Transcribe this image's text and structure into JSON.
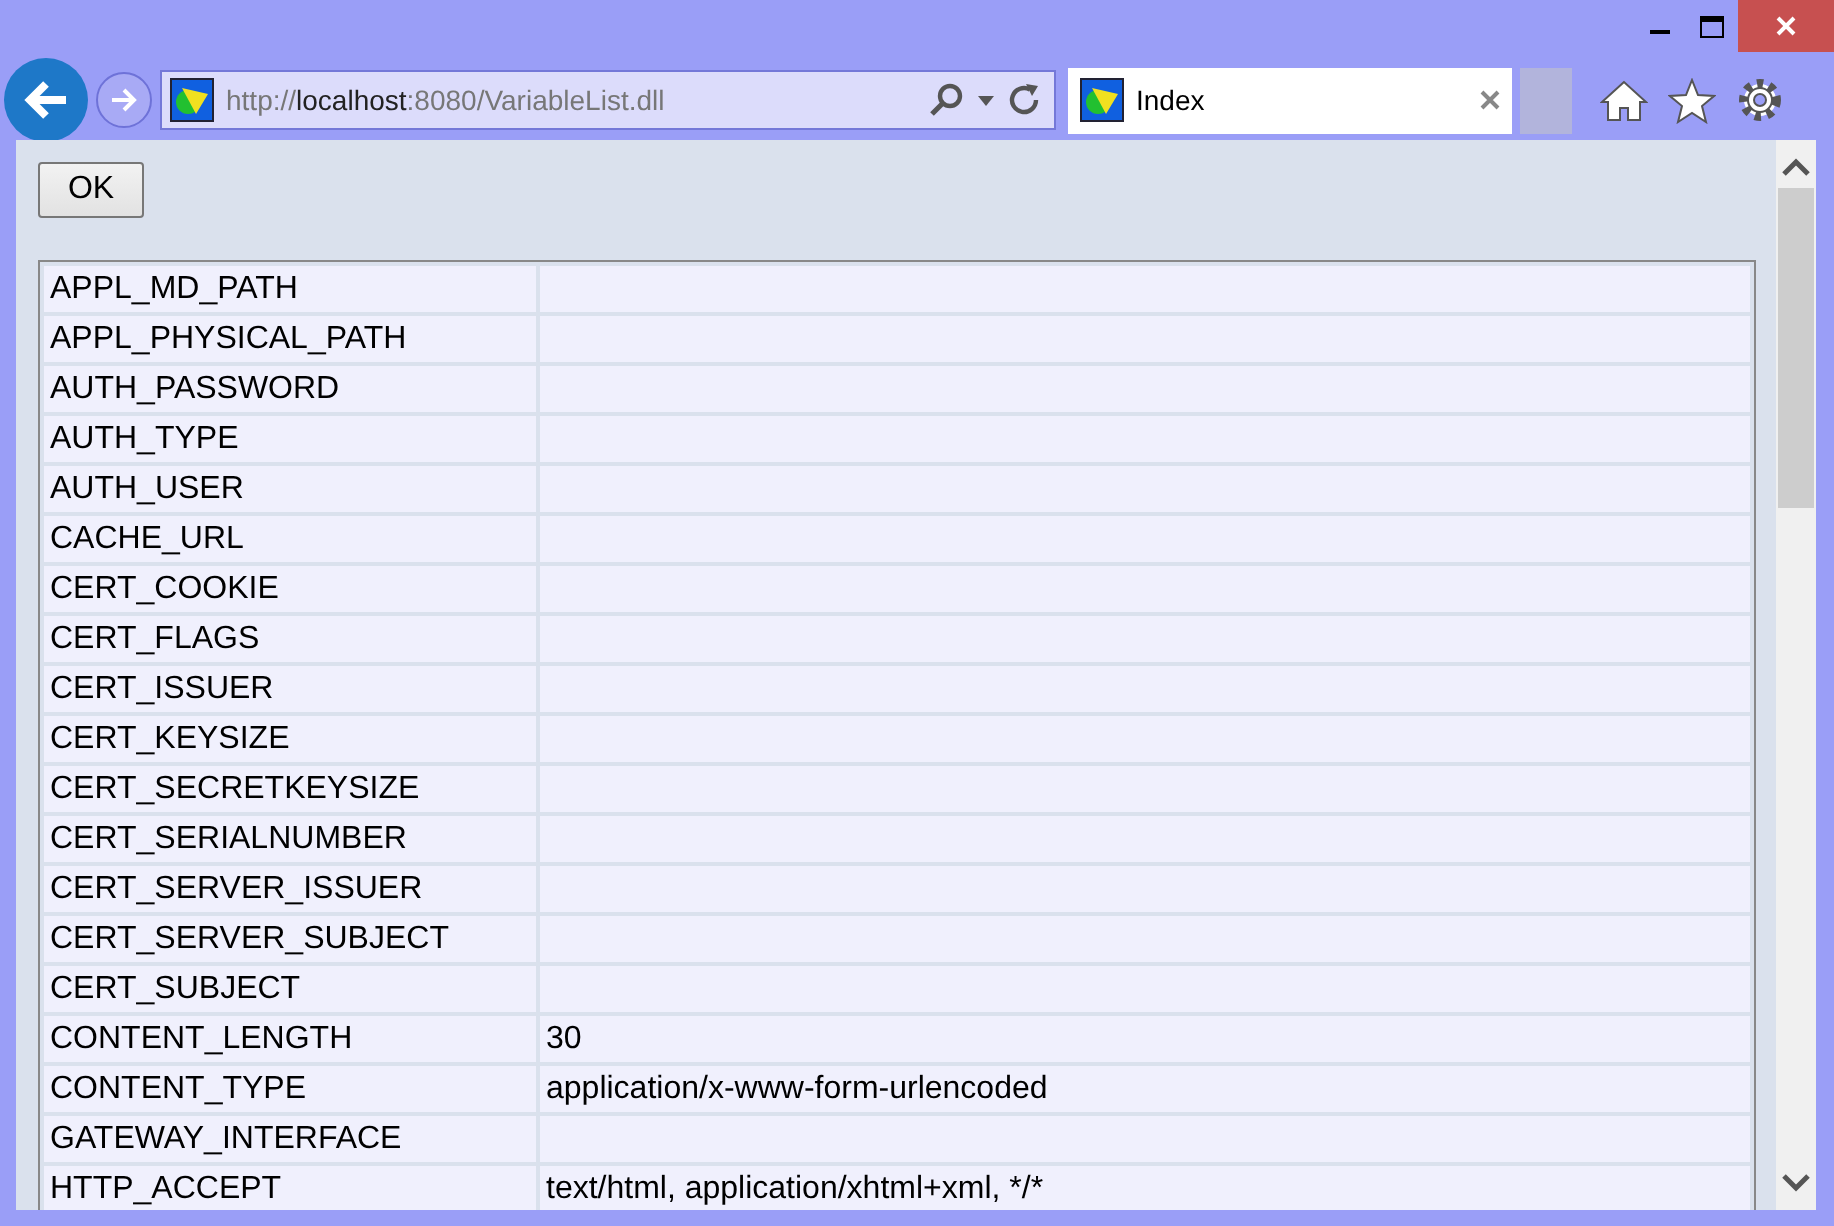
{
  "address_bar": {
    "url_prefix": "http://",
    "url_host": "localhost",
    "url_suffix": ":8080/VariableList.dll"
  },
  "tabs": [
    {
      "label": "Index",
      "selected": true
    }
  ],
  "ok_button": "OK",
  "table": {
    "rows": [
      {
        "name": "APPL_MD_PATH",
        "value": ""
      },
      {
        "name": "APPL_PHYSICAL_PATH",
        "value": ""
      },
      {
        "name": "AUTH_PASSWORD",
        "value": ""
      },
      {
        "name": "AUTH_TYPE",
        "value": ""
      },
      {
        "name": "AUTH_USER",
        "value": ""
      },
      {
        "name": "CACHE_URL",
        "value": ""
      },
      {
        "name": "CERT_COOKIE",
        "value": ""
      },
      {
        "name": "CERT_FLAGS",
        "value": ""
      },
      {
        "name": "CERT_ISSUER",
        "value": ""
      },
      {
        "name": "CERT_KEYSIZE",
        "value": ""
      },
      {
        "name": "CERT_SECRETKEYSIZE",
        "value": ""
      },
      {
        "name": "CERT_SERIALNUMBER",
        "value": ""
      },
      {
        "name": "CERT_SERVER_ISSUER",
        "value": ""
      },
      {
        "name": "CERT_SERVER_SUBJECT",
        "value": ""
      },
      {
        "name": "CERT_SUBJECT",
        "value": ""
      },
      {
        "name": "CONTENT_LENGTH",
        "value": "30"
      },
      {
        "name": "CONTENT_TYPE",
        "value": "application/x-www-form-urlencoded"
      },
      {
        "name": "GATEWAY_INTERFACE",
        "value": ""
      },
      {
        "name": "HTTP_ACCEPT",
        "value": "text/html, application/xhtml+xml, */*"
      }
    ]
  }
}
